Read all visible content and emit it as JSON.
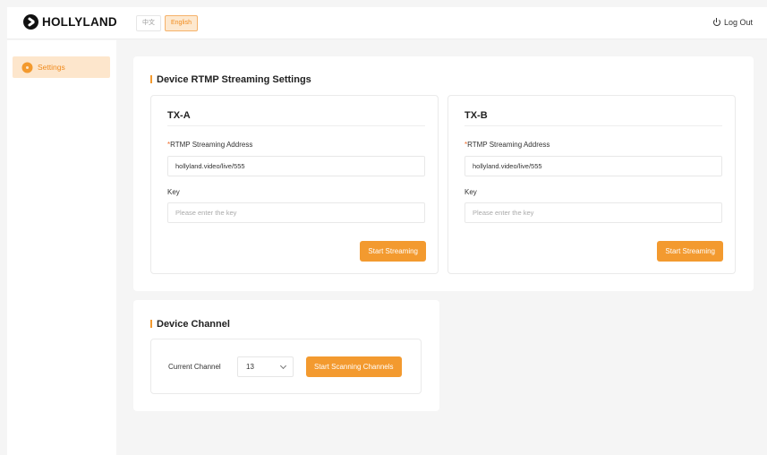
{
  "brand": {
    "name": "HOLLYLAND"
  },
  "header": {
    "languages": [
      {
        "label": "中文",
        "active": false
      },
      {
        "label": "English",
        "active": true
      }
    ],
    "logout_label": "Log Out"
  },
  "sidebar": {
    "items": [
      {
        "label": "Settings",
        "icon": "gear-icon",
        "active": true
      }
    ]
  },
  "rtmp": {
    "title": "Device RTMP Streaming Settings",
    "devices": [
      {
        "name": "TX-A",
        "address_label": "RTMP Streaming Address",
        "address_value": "hollyland.video/live/555",
        "key_label": "Key",
        "key_placeholder": "Please enter the key",
        "button_label": "Start Streaming"
      },
      {
        "name": "TX-B",
        "address_label": "RTMP Streaming Address",
        "address_value": "hollyland.video/live/555",
        "key_label": "Key",
        "key_placeholder": "Please enter the key",
        "button_label": "Start Streaming"
      }
    ]
  },
  "channel": {
    "title": "Device Channel",
    "current_label": "Current Channel",
    "current_value": "13",
    "scan_button_label": "Start Scanning Channels"
  },
  "colors": {
    "accent": "#f39a2f",
    "accent_light": "#fde6cc",
    "required": "#f06b2a"
  }
}
